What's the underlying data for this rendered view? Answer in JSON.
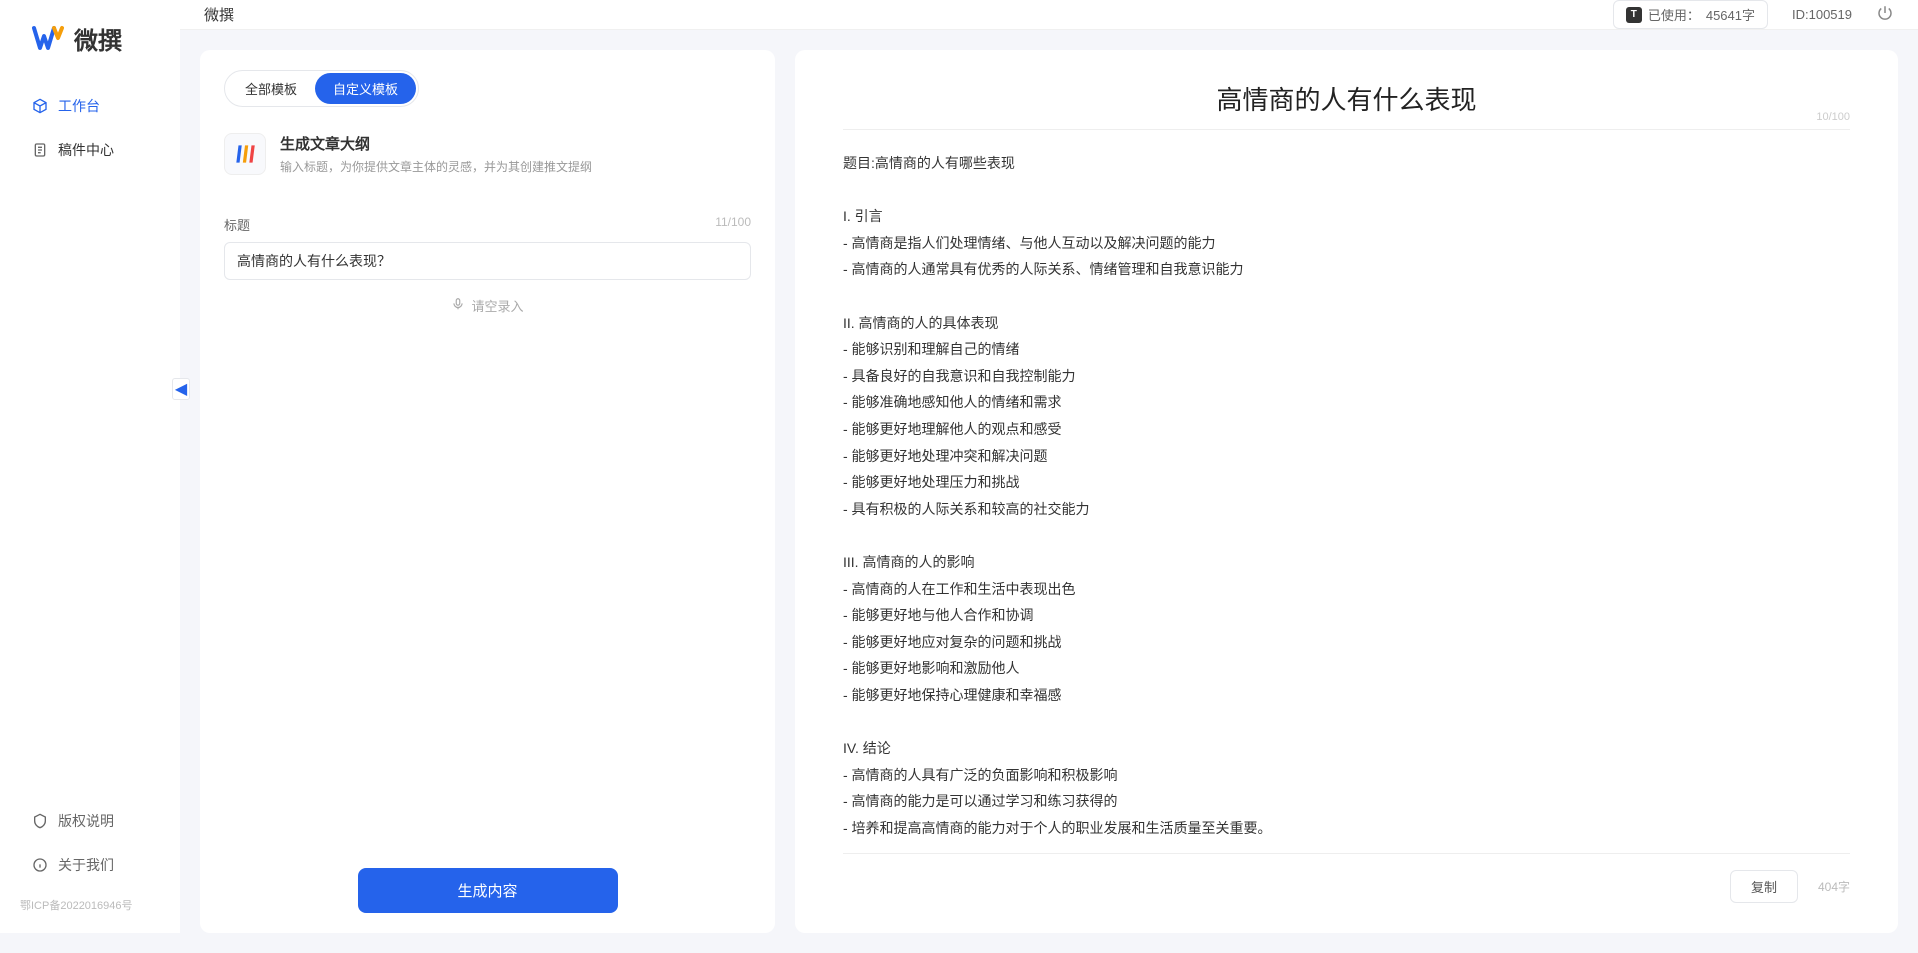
{
  "app_name": "微撰",
  "sidebar": {
    "logo_text": "微撰",
    "nav": [
      {
        "label": "工作台",
        "active": true
      },
      {
        "label": "稿件中心",
        "active": false
      }
    ],
    "footer": [
      {
        "label": "版权说明"
      },
      {
        "label": "关于我们"
      }
    ],
    "icp": "鄂ICP备2022016946号"
  },
  "topbar": {
    "title": "微撰",
    "usage_prefix": "已使用：",
    "usage_value": "45641字",
    "id_label": "ID:100519"
  },
  "left_panel": {
    "tabs": [
      {
        "label": "全部模板",
        "active": false
      },
      {
        "label": "自定义模板",
        "active": true
      }
    ],
    "template": {
      "title": "生成文章大纲",
      "desc": "输入标题，为你提供文章主体的灵感，并为其创建推文提纲"
    },
    "field_label": "标题",
    "field_counter": "11/100",
    "input_value": "高情商的人有什么表现？",
    "voice_hint": "请空录入",
    "generate_label": "生成内容"
  },
  "right_panel": {
    "title": "高情商的人有什么表现",
    "title_counter": "10/100",
    "body": "题目:高情商的人有哪些表现\n\nI. 引言\n- 高情商是指人们处理情绪、与他人互动以及解决问题的能力\n- 高情商的人通常具有优秀的人际关系、情绪管理和自我意识能力\n\nII. 高情商的人的具体表现\n- 能够识别和理解自己的情绪\n- 具备良好的自我意识和自我控制能力\n- 能够准确地感知他人的情绪和需求\n- 能够更好地理解他人的观点和感受\n- 能够更好地处理冲突和解决问题\n- 能够更好地处理压力和挑战\n- 具有积极的人际关系和较高的社交能力\n\nIII. 高情商的人的影响\n- 高情商的人在工作和生活中表现出色\n- 能够更好地与他人合作和协调\n- 能够更好地应对复杂的问题和挑战\n- 能够更好地影响和激励他人\n- 能够更好地保持心理健康和幸福感\n\nIV. 结论\n- 高情商的人具有广泛的负面影响和积极影响\n- 高情商的能力是可以通过学习和练习获得的\n- 培养和提高高情商的能力对于个人的职业发展和生活质量至关重要。",
    "copy_label": "复制",
    "char_count": "404字"
  }
}
